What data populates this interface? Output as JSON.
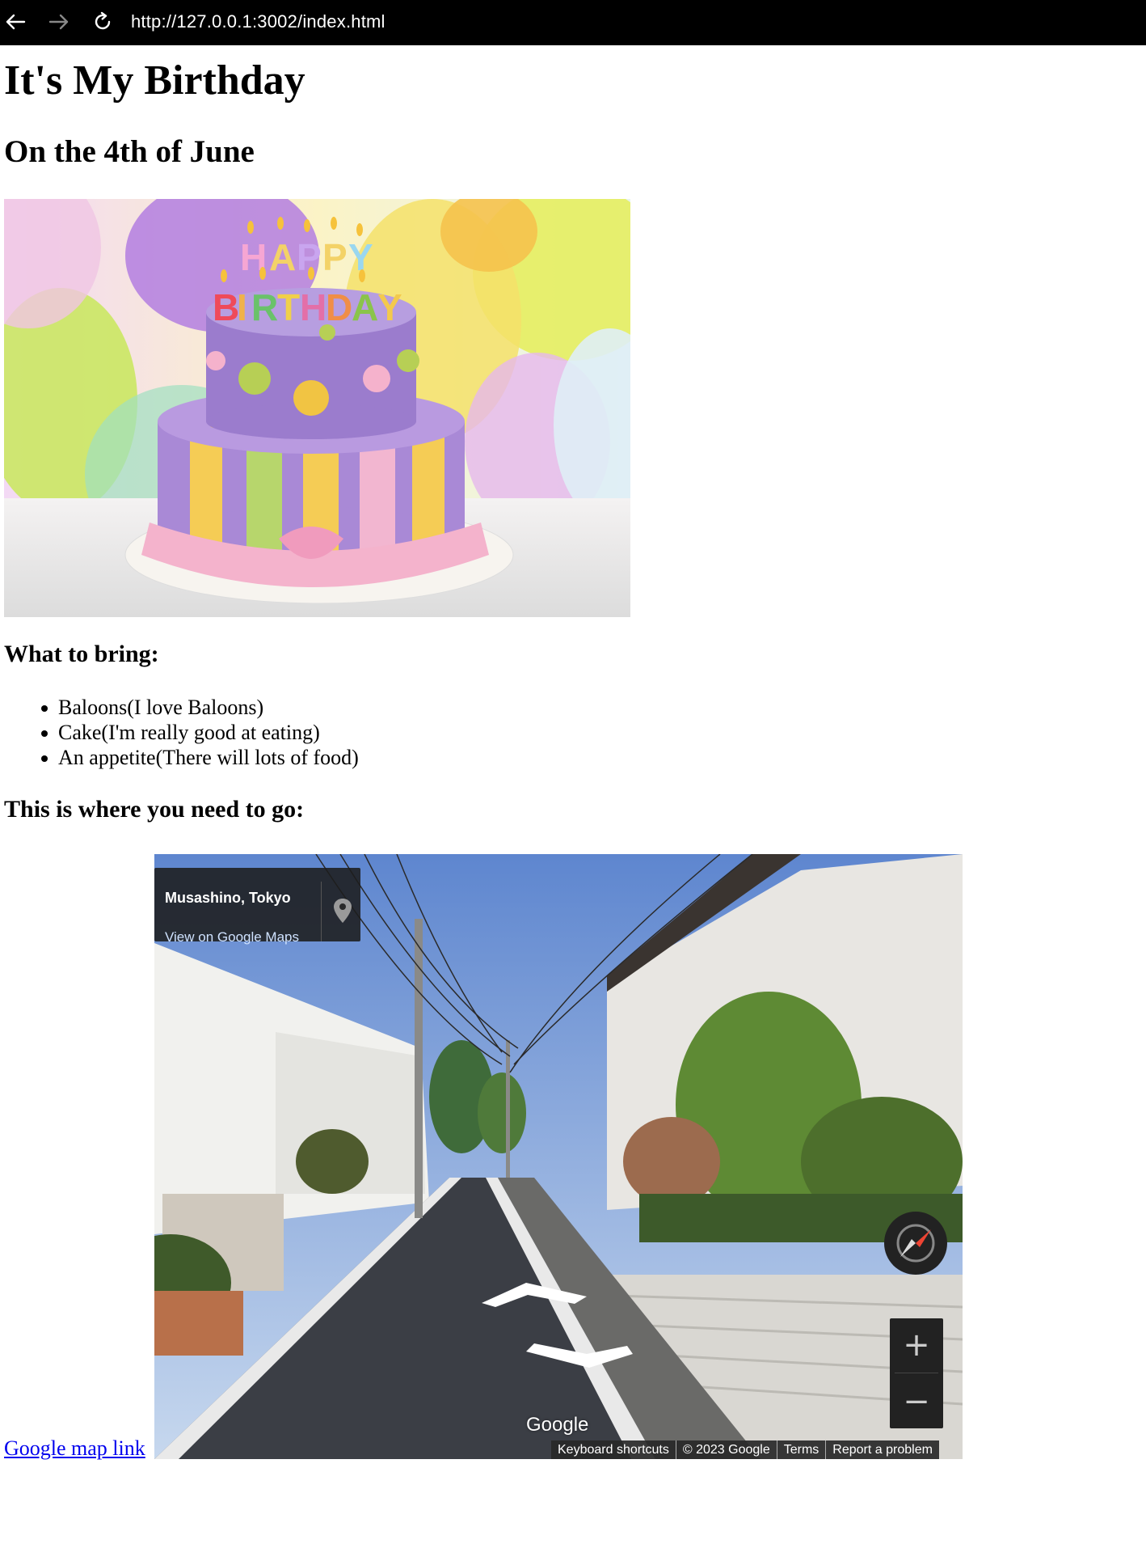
{
  "browser": {
    "url": "http://127.0.0.1:3002/index.html",
    "back_icon": "arrow-left-icon",
    "forward_icon": "arrow-right-icon",
    "reload_icon": "reload-icon"
  },
  "page": {
    "title": "It's My Birthday",
    "subtitle": "On the 4th of June",
    "bring_heading": "What to bring:",
    "items": [
      "Baloons(I love Baloons)",
      "Cake(I'm really good at eating)",
      "An appetite(There will lots of food)"
    ],
    "go_heading": "This is where you need to go:",
    "map_link_text": "Google map link"
  },
  "street_view": {
    "place": "Musashino, Tokyo",
    "view_link": "View on Google Maps",
    "logo": "Google",
    "zoom_in": "+",
    "zoom_out": "−",
    "footer": {
      "keyboard": "Keyboard shortcuts",
      "copyright": "© 2023 Google",
      "terms": "Terms",
      "report": "Report a problem"
    }
  },
  "colors": {
    "topbar": "#000000",
    "link": "#0000ee",
    "sky": "#6d8fc7"
  }
}
